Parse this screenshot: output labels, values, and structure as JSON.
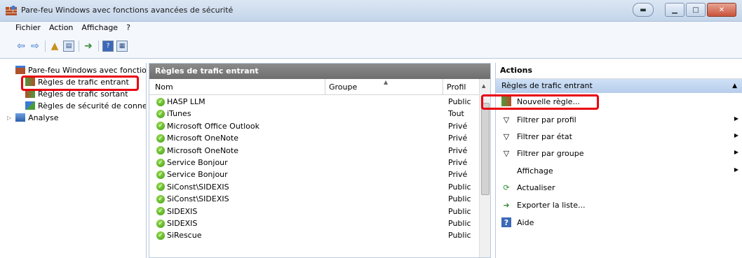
{
  "window": {
    "title": "Pare-feu Windows avec fonctions avancées de sécurité"
  },
  "menu": [
    "Fichier",
    "Action",
    "Affichage",
    "?"
  ],
  "tree": {
    "root": "Pare-feu Windows avec fonctio",
    "items": [
      "Règles de trafic entrant",
      "Règles de trafic sortant",
      "Règles de sécurité de conne",
      "Analyse"
    ]
  },
  "list": {
    "header": "Règles de trafic entrant",
    "columns": {
      "name": "Nom",
      "group": "Groupe",
      "profile": "Profil"
    },
    "rows": [
      {
        "name": "HASP LLM",
        "profile": "Public"
      },
      {
        "name": "iTunes",
        "profile": "Tout"
      },
      {
        "name": "Microsoft Office Outlook",
        "profile": "Privé"
      },
      {
        "name": "Microsoft OneNote",
        "profile": "Privé"
      },
      {
        "name": "Microsoft OneNote",
        "profile": "Privé"
      },
      {
        "name": "Service Bonjour",
        "profile": "Privé"
      },
      {
        "name": "Service Bonjour",
        "profile": "Privé"
      },
      {
        "name": "SiConst\\SIDEXIS",
        "profile": "Public"
      },
      {
        "name": "SiConst\\SIDEXIS",
        "profile": "Public"
      },
      {
        "name": "SIDEXIS",
        "profile": "Public"
      },
      {
        "name": "SIDEXIS",
        "profile": "Public"
      },
      {
        "name": "SiRescue",
        "profile": "Public"
      }
    ]
  },
  "actions": {
    "header": "Actions",
    "section": "Règles de trafic entrant",
    "items": [
      "Nouvelle règle...",
      "Filtrer par profil",
      "Filtrer par état",
      "Filtrer par groupe",
      "Affichage",
      "Actualiser",
      "Exporter la liste...",
      "Aide"
    ]
  },
  "colors": {
    "highlight": "#e8000f",
    "header_bg": "#7a7a7a",
    "section_bg": "#c2d6ef"
  }
}
